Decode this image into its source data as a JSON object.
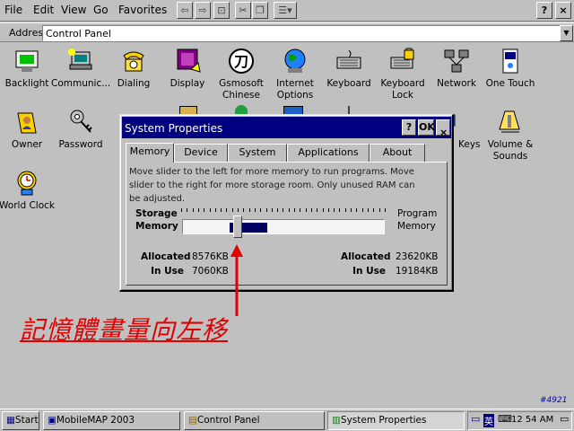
{
  "menubar": {
    "items": [
      "File",
      "Edit",
      "View",
      "Go",
      "Favorites"
    ]
  },
  "addressbar": {
    "label": "Address",
    "value": "Control Panel"
  },
  "icons": [
    {
      "label": "Backlight",
      "icon": "backlight-icon"
    },
    {
      "label": "Communic...",
      "icon": "communications-icon"
    },
    {
      "label": "Dialing",
      "icon": "dialing-icon"
    },
    {
      "label": "Display",
      "icon": "display-icon"
    },
    {
      "label": "Gsmosoft Chinese",
      "line1": "Gsmosoft",
      "line2": "Chinese",
      "icon": "gsmosoft-chinese-icon"
    },
    {
      "label": "Internet Options",
      "line1": "Internet",
      "line2": "Options",
      "icon": "internet-options-icon"
    },
    {
      "label": "Keyboard",
      "icon": "keyboard-icon"
    },
    {
      "label": "Keyboard Lock",
      "line1": "Keyboard",
      "line2": "Lock",
      "icon": "keyboard-lock-icon"
    },
    {
      "label": "Network",
      "icon": "network-icon"
    },
    {
      "label": "One Touch",
      "icon": "one-touch-icon"
    },
    {
      "label": "Owner",
      "icon": "owner-icon"
    },
    {
      "label": "Password",
      "icon": "password-icon"
    },
    {
      "label": "Keys",
      "icon": "keys-icon"
    },
    {
      "label": "Volume & Sounds",
      "line1": "Volume &",
      "line2": "Sounds",
      "icon": "volume-sounds-icon"
    },
    {
      "label": "World Clock",
      "icon": "world-clock-icon"
    }
  ],
  "dialog": {
    "title": "System Properties",
    "help": "?",
    "ok": "OK",
    "close": "×",
    "tabs": [
      "Memory",
      "Device",
      "System",
      "Applications",
      "About"
    ],
    "active_tab": "Memory",
    "description": "Move slider to the left for more memory to run programs. Move slider to the right for more storage room. Only unused RAM can be adjusted.",
    "storage_label_1": "Storage",
    "storage_label_2": "Memory",
    "program_label_1": "Program",
    "program_label_2": "Memory",
    "slider_position": 0.27,
    "left_allocated_label": "Allocated",
    "left_allocated_value": "8576KB",
    "left_inuse_label": "In Use",
    "left_inuse_value": "7060KB",
    "right_allocated_label": "Allocated",
    "right_allocated_value": "23620KB",
    "right_inuse_label": "In Use",
    "right_inuse_value": "19184KB"
  },
  "annotation": "記憶體畫量向左移",
  "taskbar": {
    "start": "Start",
    "tasks": [
      "MobileMAP 2003",
      "Control Panel",
      "System Properties"
    ],
    "time": "12 54 AM",
    "ime": "英"
  },
  "watermark": "#4921",
  "colors": {
    "title_bar": "#000080",
    "annotation": "#e00000",
    "face": "#c0c0c0"
  }
}
